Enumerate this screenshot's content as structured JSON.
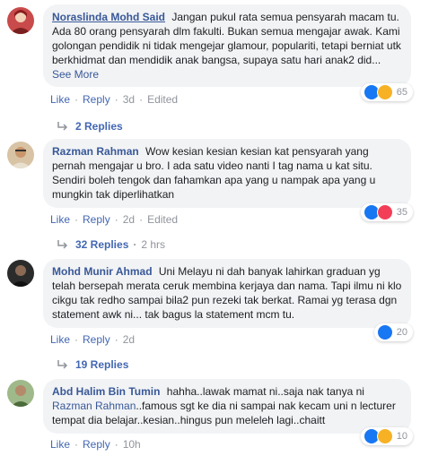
{
  "actions": {
    "like": "Like",
    "reply": "Reply",
    "sep": "·",
    "edited": "Edited"
  },
  "comments": [
    {
      "author": "Noraslinda Mohd Said",
      "text": "Jangan pukul rata semua pensyarah macam tu. Ada 80 orang pensyarah dlm fakulti. Bukan semua mengajar awak. Kami golongan pendidik ni tidak mengejar glamour, populariti, tetapi berniat utk berkhidmat dan mendidik anak bangsa, supaya satu hari anak2 did...",
      "see_more": "See More",
      "time": "3d",
      "edited": true,
      "reaction_count": "65",
      "reactions": [
        "like",
        "haha"
      ],
      "replies_label": "2 Replies",
      "replies_time": ""
    },
    {
      "author": "Razman Rahman",
      "text": "Wow kesian kesian kesian kat pensyarah yang pernah mengajar u bro. I ada satu video nanti I tag nama u kat situ. Sendiri boleh tengok dan fahamkan apa yang u nampak apa yang u mungkin tak diperlihatkan",
      "time": "2d",
      "edited": true,
      "reaction_count": "35",
      "reactions": [
        "like",
        "love"
      ],
      "replies_label": "32 Replies",
      "replies_time": "2 hrs"
    },
    {
      "author": "Mohd Munir Ahmad",
      "text": "Uni Melayu ni dah banyak lahirkan graduan yg telah bersepah merata ceruk membina kerjaya dan nama. Tapi ilmu ni klo cikgu tak redho sampai bila2 pun rezeki tak berkat. Ramai yg terasa dgn statement awk ni... tak bagus la statement mcm tu.",
      "time": "2d",
      "edited": false,
      "reaction_count": "20",
      "reactions": [
        "like"
      ],
      "replies_label": "19 Replies",
      "replies_time": ""
    },
    {
      "author": "Abd Halim Bin Tumin",
      "text_before": "hahha..lawak mamat ni..saja nak tanya ni",
      "mention": "Razman Rahman",
      "text_after": "..famous sgt ke dia ni sampai nak kecam uni n lecturer tempat dia belajar..kesian..hingus pun meleleh lagi..chaitt",
      "time": "10h",
      "edited": false,
      "reaction_count": "10",
      "reactions": [
        "like",
        "haha"
      ]
    }
  ]
}
